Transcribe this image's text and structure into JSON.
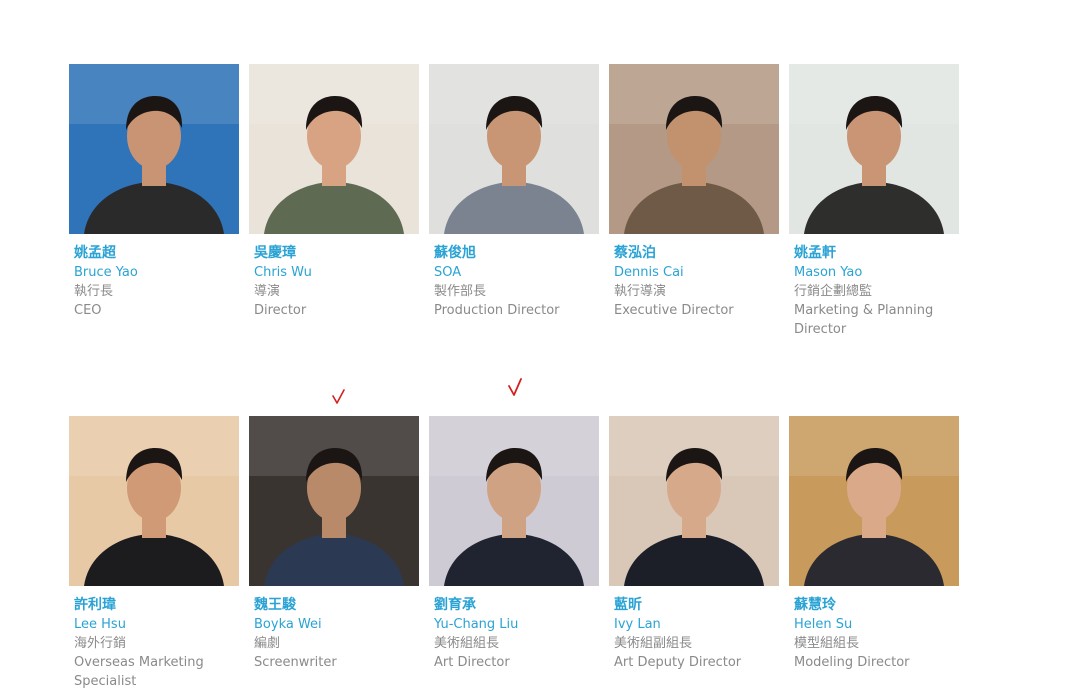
{
  "team": {
    "row1": [
      {
        "cn_name": "姚孟超",
        "en_name": "Bruce Yao",
        "cn_title": "執行長",
        "en_title": "CEO",
        "photo_bg": "#2f73b8",
        "shirt": "#2a2a2a",
        "skin": "#c99473"
      },
      {
        "cn_name": "吳慶璋",
        "en_name": "Chris Wu",
        "cn_title": "導演",
        "en_title": "Director",
        "photo_bg": "#e9e3da",
        "shirt": "#5e6a52",
        "skin": "#d7a383"
      },
      {
        "cn_name": "蘇俊旭",
        "en_name": "SOA",
        "cn_title": "製作部長",
        "en_title": "Production Director",
        "photo_bg": "#dfe0dd",
        "shirt": "#7c8390",
        "skin": "#c89674"
      },
      {
        "cn_name": "蔡泓泊",
        "en_name": "Dennis Cai",
        "cn_title": "執行導演",
        "en_title": "Executive Director",
        "photo_bg": "#b49a86",
        "shirt": "#6e5a46",
        "skin": "#c2916e"
      },
      {
        "cn_name": "姚孟軒",
        "en_name": "Mason Yao",
        "cn_title": "行銷企劃總監",
        "en_title": "Marketing & Planning Director",
        "photo_bg": "#e2e6e3",
        "shirt": "#2e2f2c",
        "skin": "#c99574"
      }
    ],
    "row2": [
      {
        "cn_name": "許利瑋",
        "en_name": "Lee Hsu",
        "cn_title": "海外行銷",
        "en_title": "Overseas Marketing Specialist",
        "photo_bg": "#e8c9a6",
        "shirt": "#1c1c1e",
        "skin": "#d09a76"
      },
      {
        "cn_name": "魏王駿",
        "en_name": "Boyka Wei",
        "cn_title": "編劇",
        "en_title": "Screenwriter",
        "photo_bg": "#3a3430",
        "shirt": "#2b3a52",
        "skin": "#b98a6a"
      },
      {
        "cn_name": "劉育承",
        "en_name": "Yu-Chang Liu",
        "cn_title": "美術組組長",
        "en_title": "Art Director",
        "photo_bg": "#cfcbd4",
        "shirt": "#1f2430",
        "skin": "#d0a284"
      },
      {
        "cn_name": "藍昕",
        "en_name": "Ivy Lan",
        "cn_title": "美術組副組長",
        "en_title": "Art Deputy Director",
        "photo_bg": "#d9c8b8",
        "shirt": "#1c1e28",
        "skin": "#d6a98a"
      },
      {
        "cn_name": "蘇慧玲",
        "en_name": "Helen Su",
        "cn_title": "模型組組長",
        "en_title": "Modeling Director",
        "photo_bg": "#c89a5c",
        "shirt": "#2a2a30",
        "skin": "#d9a98a"
      }
    ]
  },
  "colors": {
    "name_accent": "#2aa3d4",
    "title_gray": "#8a8a8a",
    "checkmark_red": "#d42020"
  }
}
